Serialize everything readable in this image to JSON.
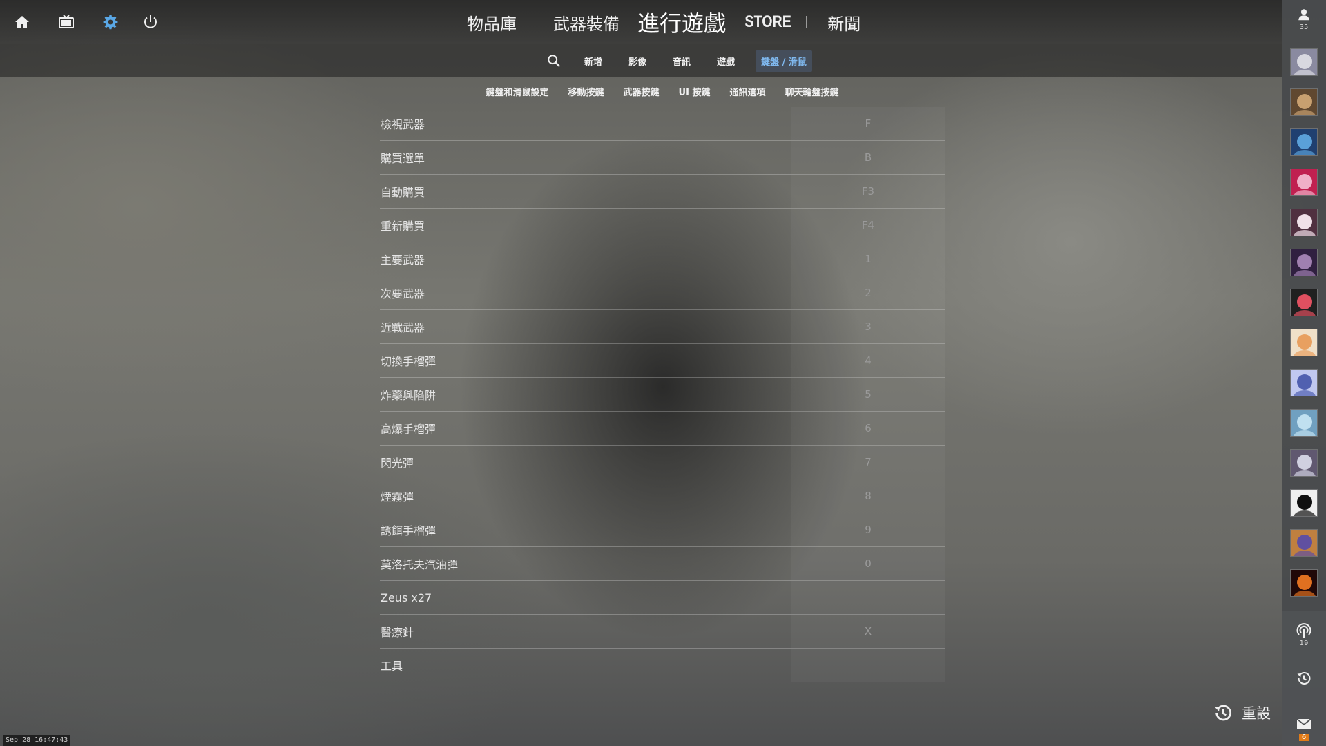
{
  "top_icons": [
    {
      "name": "home-icon"
    },
    {
      "name": "tv-icon"
    },
    {
      "name": "gear-icon",
      "color": "#5aa8e6"
    },
    {
      "name": "power-icon"
    }
  ],
  "top_nav": {
    "library": "物品庫",
    "loadout": "武器裝備",
    "play": "進行遊戲",
    "store": "STORE",
    "news": "新聞"
  },
  "sub_nav": {
    "tabs": [
      "新增",
      "影像",
      "音訊",
      "遊戲"
    ],
    "active_tab": "鍵盤 / 滑鼠"
  },
  "category_tabs": [
    "鍵盤和滑鼠設定",
    "移動按鍵",
    "武器按鍵",
    "UI 按鍵",
    "通訊選項",
    "聊天輪盤按鍵"
  ],
  "bindings": [
    {
      "label": "檢視武器",
      "key": "F"
    },
    {
      "label": "購買選單",
      "key": "B"
    },
    {
      "label": "自動購買",
      "key": "F3"
    },
    {
      "label": "重新購買",
      "key": "F4"
    },
    {
      "label": "主要武器",
      "key": "1"
    },
    {
      "label": "次要武器",
      "key": "2"
    },
    {
      "label": "近戰武器",
      "key": "3"
    },
    {
      "label": "切換手榴彈",
      "key": "4"
    },
    {
      "label": "炸藥與陷阱",
      "key": "5"
    },
    {
      "label": "高爆手榴彈",
      "key": "6"
    },
    {
      "label": "閃光彈",
      "key": "7"
    },
    {
      "label": "煙霧彈",
      "key": "8"
    },
    {
      "label": "誘餌手榴彈",
      "key": "9"
    },
    {
      "label": "莫洛托夫汽油彈",
      "key": "0"
    },
    {
      "label": "Zeus x27",
      "key": ""
    },
    {
      "label": "醫療針",
      "key": "X"
    },
    {
      "label": "工具",
      "key": ""
    }
  ],
  "reset": {
    "label": "重設"
  },
  "timestamp": "Sep 28 16:47:43",
  "sidebar": {
    "friends_count": "35",
    "friend_avatars": [
      {
        "name": "friend-avatar-1",
        "colors": [
          "#d8d8e0",
          "#8a8aa0"
        ]
      },
      {
        "name": "friend-avatar-2",
        "colors": [
          "#c8a070",
          "#604830"
        ]
      },
      {
        "name": "friend-avatar-3",
        "colors": [
          "#5aa0d8",
          "#204070"
        ]
      },
      {
        "name": "friend-avatar-4",
        "colors": [
          "#f0b0c8",
          "#c02050"
        ]
      },
      {
        "name": "friend-avatar-5",
        "colors": [
          "#f0e0e8",
          "#503040"
        ]
      },
      {
        "name": "friend-avatar-6",
        "colors": [
          "#a080b0",
          "#302040"
        ]
      },
      {
        "name": "friend-avatar-7",
        "colors": [
          "#e05060",
          "#202020"
        ]
      },
      {
        "name": "friend-avatar-8",
        "colors": [
          "#e8a060",
          "#f0e0c8"
        ]
      },
      {
        "name": "friend-avatar-9",
        "colors": [
          "#5060b0",
          "#c0c8f0"
        ]
      },
      {
        "name": "friend-avatar-10",
        "colors": [
          "#c0e0f0",
          "#70a0c0"
        ]
      },
      {
        "name": "friend-avatar-11",
        "colors": [
          "#d0d0e0",
          "#605870"
        ]
      },
      {
        "name": "friend-avatar-12",
        "colors": [
          "#101010",
          "#f0f0f0"
        ]
      },
      {
        "name": "friend-avatar-13",
        "colors": [
          "#6050a0",
          "#c08040"
        ]
      },
      {
        "name": "friend-avatar-14",
        "colors": [
          "#e07020",
          "#200808"
        ]
      }
    ],
    "broadcast_count": "19",
    "mail_count": "6"
  }
}
